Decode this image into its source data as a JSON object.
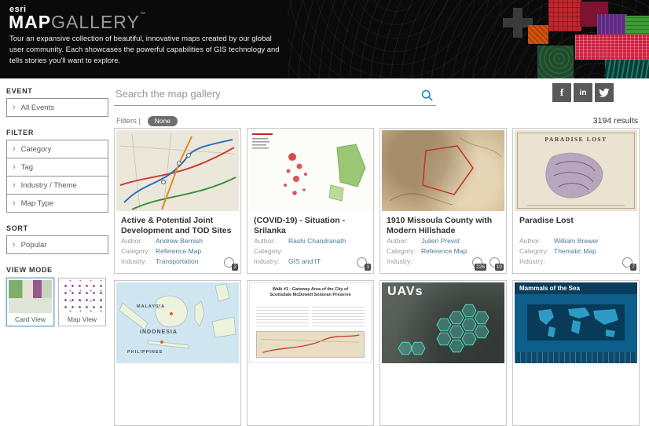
{
  "header": {
    "logo": "esri",
    "title_bold": "MAP",
    "title_light": "GALLERY",
    "title_tm": "™",
    "description": "Tour an expansive collection of beautiful, innovative maps created by our global user community. Each showcases the powerful capabilities of GIS technology and tells stories you'll want to explore."
  },
  "icons": {
    "chevron": "›",
    "facebook": "f",
    "linkedin": "in"
  },
  "sidebar": {
    "event_label": "EVENT",
    "all_events": "All Events",
    "filter_label": "FILTER",
    "filter_category": "Category",
    "filter_tag": "Tag",
    "filter_industry": "Industry / Theme",
    "filter_maptype": "Map Type",
    "sort_label": "SORT",
    "sort_value": "Popular",
    "view_mode_label": "VIEW MODE",
    "card_view": "Card View",
    "map_view": "Map View"
  },
  "toolbar": {
    "search_placeholder": "Search the map gallery",
    "filters_label": "Filters |",
    "filters_none": "None",
    "results": "3194 results"
  },
  "labels": {
    "author": "Author:",
    "category": "Category:",
    "industry": "Industry:"
  },
  "cards": [
    {
      "title": "Active & Potential Joint Development and TOD Sites in",
      "author": "Andrew Bernish",
      "category": "Reference Map",
      "industry": "Transportation",
      "badge": "2"
    },
    {
      "title": "(COVID-19) - Situation - Srilanka",
      "author": "Rashi Chandranath",
      "category": "",
      "industry": "GIS and IT",
      "badge": "1"
    },
    {
      "title": "1910 Missoula County with Modern Hillshade",
      "author": "Julien Prevot",
      "category": "Reference Map",
      "industry": "",
      "badge": "226",
      "badge2": "10"
    },
    {
      "title": "Paradise Lost",
      "author": "William Brewer",
      "category": "Thematic Map",
      "industry": "",
      "badge": "7",
      "thumb_title": "PARADISE LOST"
    }
  ],
  "row2": [
    {
      "label1": "INDONESIA",
      "label2": "MALAYSIA",
      "label3": "PHILIPPINES"
    },
    {
      "doc_title": "Walk #1 - Gateway Area of the City of Scottsdale McDowell Sonoran Preserve"
    },
    {
      "label": "UAVs"
    },
    {
      "label": "Mammals of the Sea"
    }
  ]
}
